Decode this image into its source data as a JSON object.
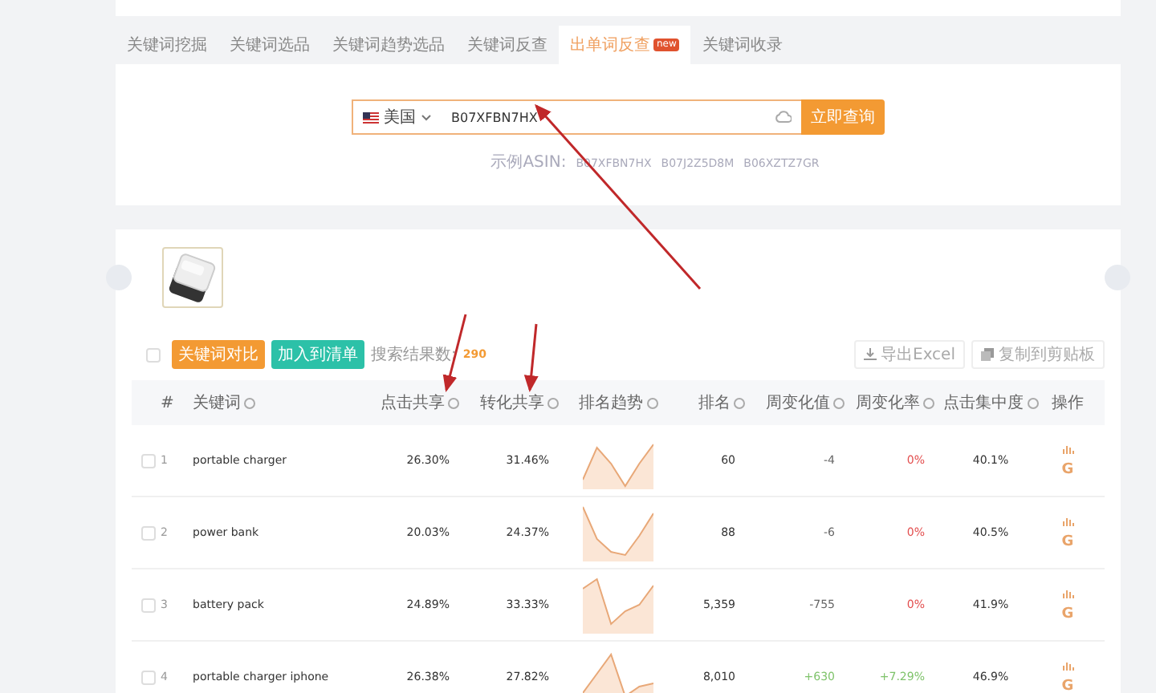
{
  "tabs": [
    {
      "label": "关键词挖掘",
      "selected": false
    },
    {
      "label": "关键词选品",
      "selected": false
    },
    {
      "label": "关键词趋势选品",
      "selected": false
    },
    {
      "label": "关键词反查",
      "selected": false
    },
    {
      "label": "出单词反查",
      "selected": true,
      "badge": "new"
    },
    {
      "label": "关键词收录",
      "selected": false
    }
  ],
  "search": {
    "country": "美国",
    "value": "B07XFBN7HX",
    "button": "立即查询",
    "examples_label": "示例ASIN:",
    "examples": [
      "B07XFBN7HX",
      "B07J2Z5D8M",
      "B06XZTZ7GR"
    ]
  },
  "toolbar": {
    "select_all_checked": false,
    "compare_button": "关键词对比",
    "add_button": "加入到清单",
    "result_label": "搜索结果数:",
    "result_count": "290",
    "export_button": "导出Excel",
    "copy_button": "复制到剪贴板"
  },
  "table": {
    "columns": [
      {
        "label": "#",
        "help": false
      },
      {
        "label": "关键词",
        "help": true
      },
      {
        "label": "点击共享",
        "help": true
      },
      {
        "label": "转化共享",
        "help": true
      },
      {
        "label": "排名趋势",
        "help": true
      },
      {
        "label": "排名",
        "help": true
      },
      {
        "label": "周变化值",
        "help": true
      },
      {
        "label": "周变化率",
        "help": true
      },
      {
        "label": "点击集中度",
        "help": true
      },
      {
        "label": "操作",
        "help": false
      }
    ],
    "rows": [
      {
        "checked": false,
        "index": "1",
        "keyword": "portable charger",
        "click_share": "26.30%",
        "conversion_share": "31.46%",
        "rank": "60",
        "change": {
          "text": "-4",
          "color": "#666666"
        },
        "rate": {
          "text": "0%",
          "color": "#e35050"
        },
        "concentration": "40.1%",
        "action": "G"
      },
      {
        "checked": false,
        "index": "2",
        "keyword": "power bank",
        "click_share": "20.03%",
        "conversion_share": "24.37%",
        "rank": "88",
        "change": {
          "text": "-6",
          "color": "#666666"
        },
        "rate": {
          "text": "0%",
          "color": "#e35050"
        },
        "concentration": "40.5%",
        "action": "G"
      },
      {
        "checked": false,
        "index": "3",
        "keyword": "battery pack",
        "click_share": "24.89%",
        "conversion_share": "33.33%",
        "rank": "5,359",
        "change": {
          "text": "-755",
          "color": "#666666"
        },
        "rate": {
          "text": "0%",
          "color": "#e35050"
        },
        "concentration": "41.9%",
        "action": "G"
      },
      {
        "checked": false,
        "index": "4",
        "keyword": "portable charger iphone",
        "click_share": "26.38%",
        "conversion_share": "27.82%",
        "rank": "8,010",
        "change": {
          "text": "+630",
          "color": "#7fc36b"
        },
        "rate": {
          "text": "+7.29%",
          "color": "#7fc36b"
        },
        "concentration": "46.9%",
        "action": "G"
      }
    ]
  }
}
